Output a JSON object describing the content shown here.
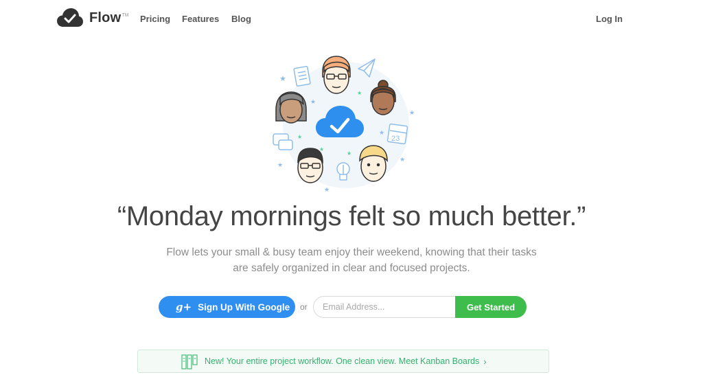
{
  "nav": {
    "brand": "Flow",
    "trademark": "TM",
    "links": [
      "Pricing",
      "Features",
      "Blog"
    ],
    "login": "Log In"
  },
  "hero": {
    "calendar_day": "23",
    "headline": "“Monday mornings felt so much better.”",
    "subtitle_line1": "Flow lets your small & busy team enjoy their weekend, knowing that their tasks",
    "subtitle_line2": "are safely organized in clear and focused projects."
  },
  "cta": {
    "google_icon": "g+",
    "google_label": "Sign Up With Google",
    "or": "or",
    "email_placeholder": "Email Address...",
    "submit_label": "Get Started"
  },
  "banner": {
    "text": "New! Your entire project workflow. One clean view. Meet Kanban Boards",
    "chevron": "›"
  },
  "colors": {
    "primary_blue": "#2f8ff0",
    "green": "#3ebd4c",
    "banner_green": "#33b06d"
  }
}
